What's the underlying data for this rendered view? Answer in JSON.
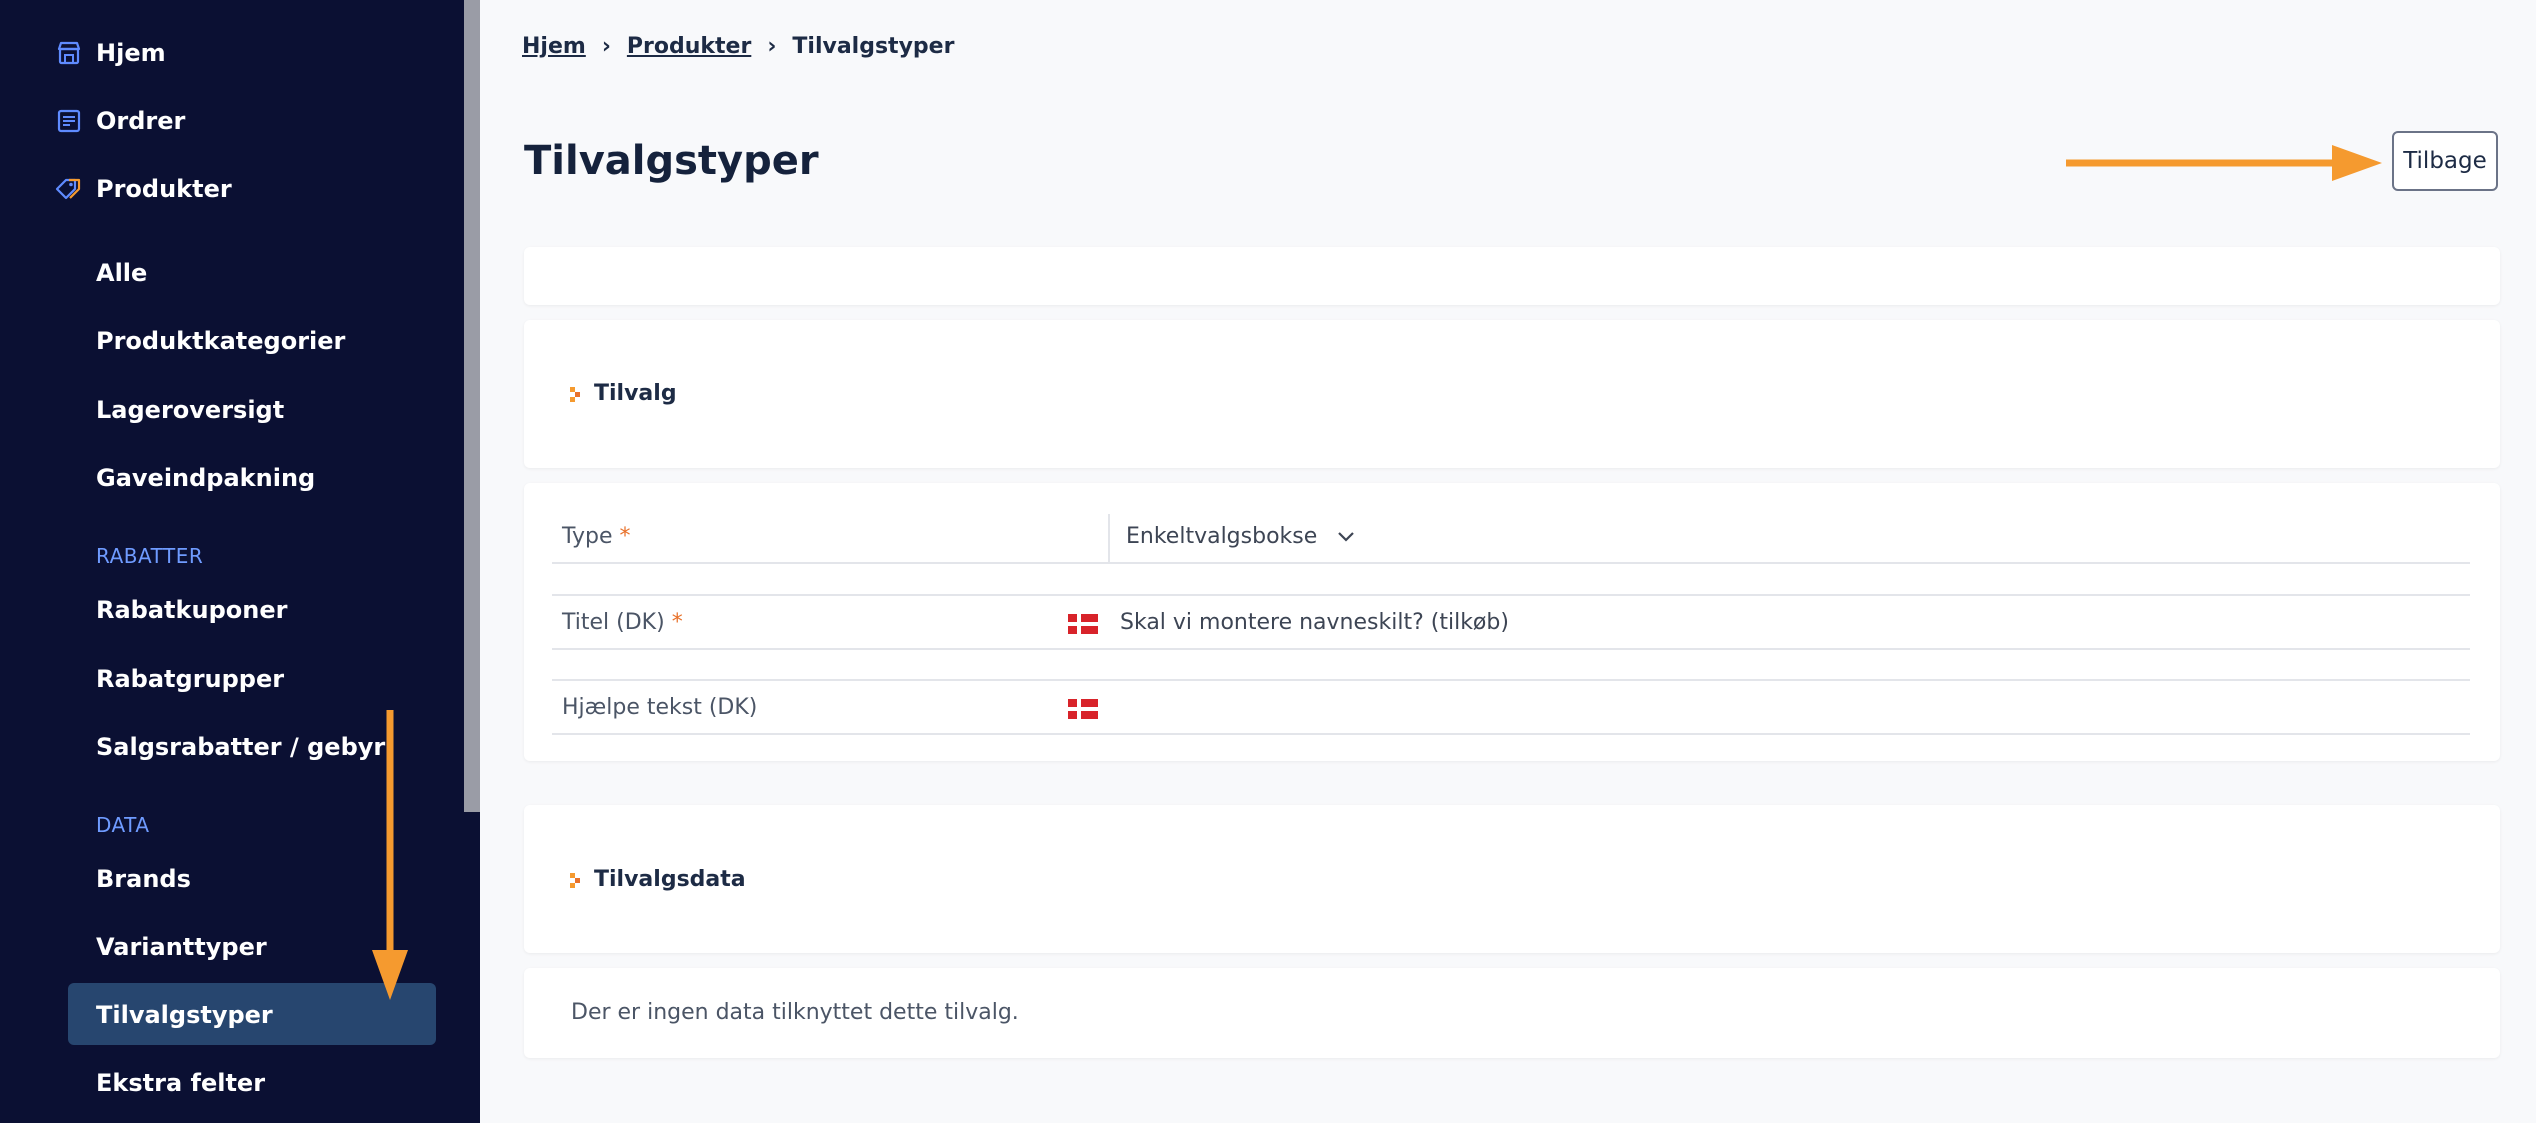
{
  "sidebar": {
    "top_items": [
      {
        "label": "Hjem",
        "icon": "shop-icon"
      },
      {
        "label": "Ordrer",
        "icon": "list-icon"
      },
      {
        "label": "Produkter",
        "icon": "tag-icon"
      }
    ],
    "product_items": [
      "Alle",
      "Produktkategorier",
      "Lageroversigt",
      "Gaveindpakning"
    ],
    "section_rabatter": "RABATTER",
    "rabatter_items": [
      "Rabatkuponer",
      "Rabatgrupper",
      "Salgsrabatter / gebyr"
    ],
    "section_data": "DATA",
    "data_items": [
      "Brands",
      "Varianttyper",
      "Tilvalgstyper",
      "Ekstra felter"
    ],
    "active_item": "Tilvalgstyper"
  },
  "breadcrumb": {
    "items": [
      "Hjem",
      "Produkter",
      "Tilvalgstyper"
    ]
  },
  "page": {
    "title": "Tilvalgstyper",
    "back_button": "Tilbage"
  },
  "section_tilvalg": {
    "title": "Tilvalg",
    "type_label": "Type",
    "type_value": "Enkeltvalgsbokse",
    "title_label": "Titel (DK)",
    "title_value": "Skal vi montere navneskilt? (tilkøb)",
    "help_label": "Hjælpe tekst (DK)",
    "help_value": "",
    "required_mark": "*"
  },
  "section_tilvalgsdata": {
    "title": "Tilvalgsdata",
    "empty_text": "Der er ingen data tilknyttet dette tilvalg."
  },
  "colors": {
    "sidebar_bg": "#0b1033",
    "sidebar_active": "#27466f",
    "section_label": "#6f9bff",
    "accent_arrow": "#f59a2f",
    "required": "#e8712a"
  }
}
